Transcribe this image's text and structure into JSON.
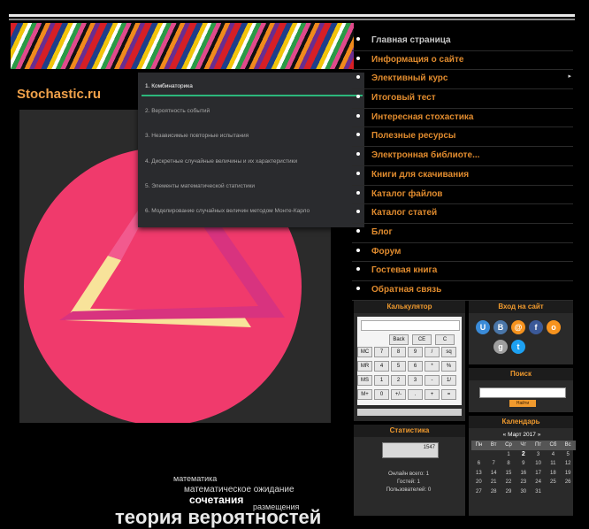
{
  "site": {
    "title": "Stochastic.ru"
  },
  "dropdown": {
    "items": [
      "1. Комбинаторика",
      "2. Вероятность событий",
      "3. Независимые повторные испытания",
      "4. Дискретные случайные величины и их характеристики",
      "5. Элементы математической статистики",
      "6. Моделирование случайных величин методом Монте-Карло"
    ]
  },
  "nav": {
    "items": [
      "Главная страница",
      "Информация о сайте",
      "Элективный курс",
      "Итоговый тест",
      "Интересная стохастика",
      "Полезные ресурсы",
      "Электронная библиоте...",
      "Книги для скачивания",
      "Каталог файлов",
      "Каталог статей",
      "Блог",
      "Форум",
      "Гостевая книга",
      "Обратная связь"
    ]
  },
  "calculator": {
    "title": "Калькулятор",
    "row1": [
      "Back",
      "CE",
      "C"
    ],
    "rows": [
      [
        "MC",
        "7",
        "8",
        "9",
        "/",
        "sq"
      ],
      [
        "MR",
        "4",
        "5",
        "6",
        "*",
        "%"
      ],
      [
        "MS",
        "1",
        "2",
        "3",
        "-",
        "1/"
      ],
      [
        "M+",
        "0",
        "+/-",
        ".",
        "+",
        "="
      ]
    ]
  },
  "login": {
    "title": "Вход на сайт"
  },
  "search": {
    "title": "Поиск",
    "button": "Найти"
  },
  "statistics": {
    "title": "Статистика",
    "counter": "1547",
    "online": "Онлайн всего: 1",
    "guests": "Гостей: 1",
    "users": "Пользователей: 0"
  },
  "calendar": {
    "title": "Календарь",
    "month": "« Март 2017 »",
    "weekdays": [
      "Пн",
      "Вт",
      "Ср",
      "Чт",
      "Пт",
      "Сб",
      "Вс"
    ],
    "weeks": [
      [
        "",
        "",
        "1",
        "2",
        "3",
        "4",
        "5"
      ],
      [
        "6",
        "7",
        "8",
        "9",
        "10",
        "11",
        "12"
      ],
      [
        "13",
        "14",
        "15",
        "16",
        "17",
        "18",
        "19"
      ],
      [
        "20",
        "21",
        "22",
        "23",
        "24",
        "25",
        "26"
      ],
      [
        "27",
        "28",
        "29",
        "30",
        "31",
        "",
        ""
      ]
    ]
  },
  "tags": [
    "математика",
    "математическое ожидание",
    "сочетания",
    "размещения",
    "теория вероятностей"
  ],
  "colors": {
    "accent": "#e08b2e",
    "menu_underline": "#2cb77b",
    "circle": "#f03a6c",
    "triangle_light": "#f8e39a"
  }
}
